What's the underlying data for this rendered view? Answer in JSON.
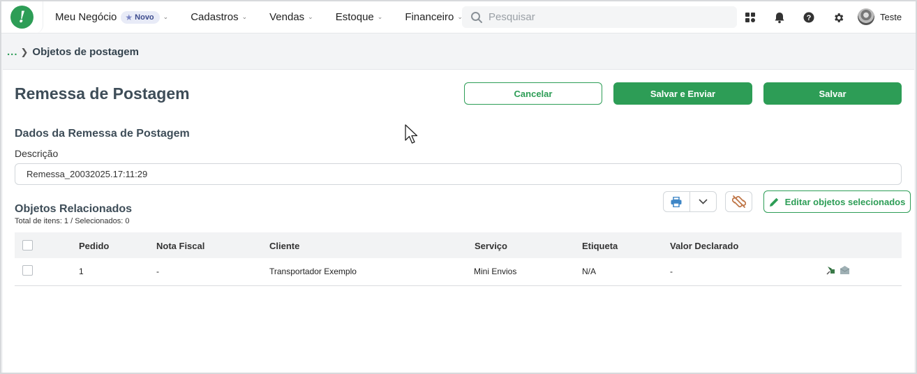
{
  "topbar": {
    "brand": "Meu Negócio",
    "brand_badge": "Novo",
    "menu": [
      {
        "label": "Cadastros"
      },
      {
        "label": "Vendas"
      },
      {
        "label": "Estoque"
      },
      {
        "label": "Financeiro"
      }
    ],
    "search_placeholder": "Pesquisar",
    "user_name": "Teste",
    "icons": [
      "grid-icon",
      "bell-icon",
      "help-icon",
      "gear-icon"
    ]
  },
  "breadcrumb": {
    "ellipsis": "...",
    "current": "Objetos de postagem"
  },
  "page": {
    "title": "Remessa de Postagem",
    "buttons": {
      "cancel": "Cancelar",
      "save_send": "Salvar e Enviar",
      "save": "Salvar"
    }
  },
  "remessa": {
    "section_title": "Dados da Remessa de Postagem",
    "description_label": "Descrição",
    "description_value": "Remessa_20032025.17:11:29"
  },
  "objetos": {
    "section_title": "Objetos Relacionados",
    "totals": "Total de itens: 1 / Selecionados: 0",
    "edit_button": "Editar objetos selecionados",
    "columns": [
      "Pedido",
      "Nota Fiscal",
      "Cliente",
      "Serviço",
      "Etiqueta",
      "Valor Declarado"
    ],
    "rows": [
      {
        "pedido": "1",
        "nota_fiscal": "-",
        "cliente": "Transportador Exemplo",
        "servico": "Mini Envios",
        "etiqueta": "N/A",
        "valor_declarado": "-"
      }
    ]
  },
  "colors": {
    "accent": "#2d9d56",
    "unlink_icon": "#c0784a"
  }
}
